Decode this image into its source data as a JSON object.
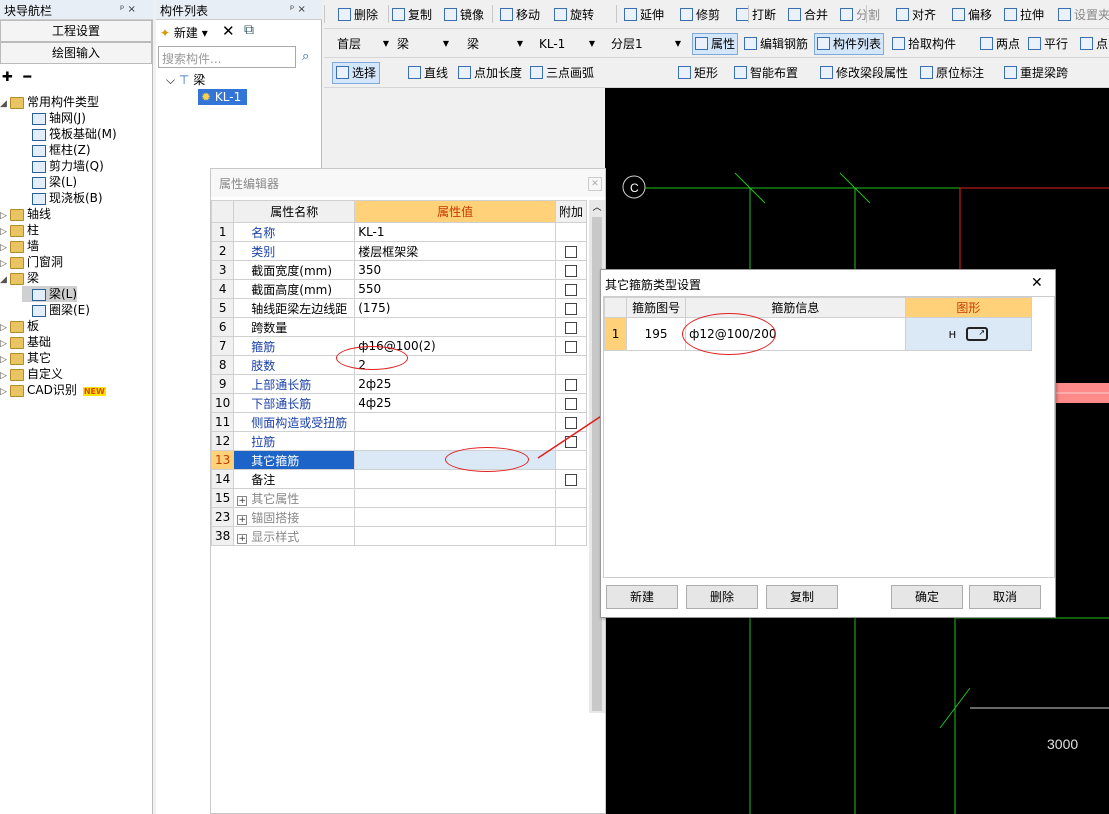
{
  "nav": {
    "title": "块导航栏",
    "pin": "ᵖ ×",
    "btn_project": "工程设置",
    "btn_draw": "绘图输入",
    "tree": [
      {
        "label": "常用构件类型",
        "level": 0,
        "folder": true,
        "open": true
      },
      {
        "label": "轴网(J)",
        "level": 1
      },
      {
        "label": "筏板基础(M)",
        "level": 1
      },
      {
        "label": "框柱(Z)",
        "level": 1
      },
      {
        "label": "剪力墙(Q)",
        "level": 1
      },
      {
        "label": "梁(L)",
        "level": 1
      },
      {
        "label": "现浇板(B)",
        "level": 1
      },
      {
        "label": "轴线",
        "level": 0,
        "folder": true
      },
      {
        "label": "柱",
        "level": 0,
        "folder": true
      },
      {
        "label": "墙",
        "level": 0,
        "folder": true
      },
      {
        "label": "门窗洞",
        "level": 0,
        "folder": true
      },
      {
        "label": "梁",
        "level": 0,
        "folder": true,
        "open": true
      },
      {
        "label": "梁(L)",
        "level": 1,
        "selected": true
      },
      {
        "label": "圈梁(E)",
        "level": 1
      },
      {
        "label": "板",
        "level": 0,
        "folder": true
      },
      {
        "label": "基础",
        "level": 0,
        "folder": true
      },
      {
        "label": "其它",
        "level": 0,
        "folder": true
      },
      {
        "label": "自定义",
        "level": 0,
        "folder": true
      },
      {
        "label": "CAD识别",
        "level": 0,
        "folder": true,
        "badge": "NEW"
      }
    ]
  },
  "complist": {
    "title": "构件列表",
    "pin": "ᵖ ×",
    "new_label": "新建",
    "search_placeholder": "搜索构件...",
    "tree_root": "梁",
    "tree_item": "KL-1"
  },
  "toolbar1": [
    "删除",
    "复制",
    "镜像",
    "移动",
    "旋转",
    "延伸",
    "修剪",
    "打断",
    "合并",
    "分割",
    "对齐",
    "偏移",
    "拉伸",
    "设置夹点"
  ],
  "toolbar2": {
    "floor": "首层",
    "type1": "梁",
    "type2": "梁",
    "comp": "KL-1",
    "layer": "分层1",
    "items": [
      "属性",
      "编辑钢筋",
      "构件列表",
      "拾取构件",
      "两点",
      "平行",
      "点"
    ]
  },
  "toolbar3": [
    "选择",
    "直线",
    "点加长度",
    "三点画弧",
    "矩形",
    "智能布置",
    "修改梁段属性",
    "原位标注",
    "重提梁跨"
  ],
  "canvas": {
    "axis_label": "C",
    "dim_text": "3000"
  },
  "prop_editor": {
    "title": "属性编辑器",
    "headers": {
      "name": "属性名称",
      "value": "属性值",
      "extra": "附加"
    },
    "rows": [
      {
        "n": "1",
        "name": "名称",
        "value": "KL-1",
        "blue": true,
        "chk": false
      },
      {
        "n": "2",
        "name": "类别",
        "value": "楼层框架梁",
        "blue": true,
        "chk": true
      },
      {
        "n": "3",
        "name": "截面宽度(mm)",
        "value": "350",
        "blue": false,
        "chk": true
      },
      {
        "n": "4",
        "name": "截面高度(mm)",
        "value": "550",
        "blue": false,
        "chk": true
      },
      {
        "n": "5",
        "name": "轴线距梁左边线距",
        "value": "(175)",
        "blue": false,
        "chk": true
      },
      {
        "n": "6",
        "name": "跨数量",
        "value": "",
        "blue": false,
        "chk": true
      },
      {
        "n": "7",
        "name": "箍筋",
        "value": "ф16@100(2)",
        "blue": true,
        "chk": true
      },
      {
        "n": "8",
        "name": "肢数",
        "value": "2",
        "blue": true,
        "chk": false
      },
      {
        "n": "9",
        "name": "上部通长筋",
        "value": "2ф25",
        "blue": true,
        "chk": true
      },
      {
        "n": "10",
        "name": "下部通长筋",
        "value": "4ф25",
        "blue": true,
        "chk": true
      },
      {
        "n": "11",
        "name": "侧面构造或受扭筋",
        "value": "",
        "blue": true,
        "chk": true
      },
      {
        "n": "12",
        "name": "拉筋",
        "value": "",
        "blue": true,
        "chk": true
      },
      {
        "n": "13",
        "name": "其它箍筋",
        "value": "",
        "blue": false,
        "chk": false,
        "selected": true
      },
      {
        "n": "14",
        "name": "备注",
        "value": "",
        "blue": false,
        "chk": true
      },
      {
        "n": "15",
        "name": "其它属性",
        "value": "",
        "blue": false,
        "chk": false,
        "group": true
      },
      {
        "n": "23",
        "name": "锚固搭接",
        "value": "",
        "blue": false,
        "chk": false,
        "group": true
      },
      {
        "n": "38",
        "name": "显示样式",
        "value": "",
        "blue": false,
        "chk": false,
        "group": true
      }
    ]
  },
  "dialog": {
    "title": "其它箍筋类型设置",
    "close": "✕",
    "headers": {
      "code": "箍筋图号",
      "info": "箍筋信息",
      "shape": "图形"
    },
    "row": {
      "n": "1",
      "code": "195",
      "info": "ф12@100/200",
      "shape_label": "H"
    },
    "buttons": {
      "new": "新建",
      "delete": "删除",
      "copy": "复制",
      "ok": "确定",
      "cancel": "取消"
    }
  }
}
